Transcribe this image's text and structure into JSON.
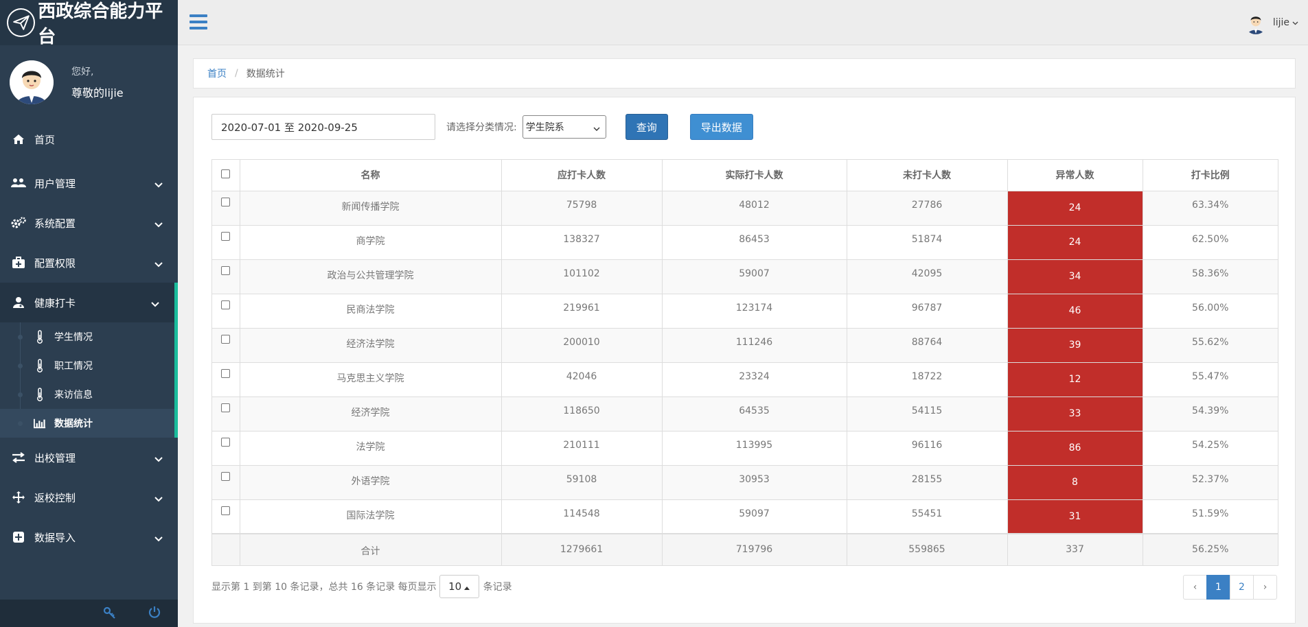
{
  "brand": {
    "title": "西政综合能力平台"
  },
  "profile": {
    "greeting": "您好,",
    "name": "尊敬的lijie"
  },
  "sidebar": {
    "items": [
      {
        "label": "首页",
        "icon": "home-icon"
      },
      {
        "label": "用户管理",
        "icon": "users-icon"
      },
      {
        "label": "系统配置",
        "icon": "gears-icon"
      },
      {
        "label": "配置权限",
        "icon": "medkit-icon"
      },
      {
        "label": "健康打卡",
        "icon": "user-md-icon"
      },
      {
        "label": "出校管理",
        "icon": "exchange-icon"
      },
      {
        "label": "返校控制",
        "icon": "move-icon"
      },
      {
        "label": "数据导入",
        "icon": "plus-square-icon"
      }
    ],
    "sub_items": [
      {
        "label": "学生情况",
        "icon": "thermometer-icon"
      },
      {
        "label": "职工情况",
        "icon": "thermometer-icon"
      },
      {
        "label": "来访信息",
        "icon": "thermometer-icon"
      },
      {
        "label": "数据统计",
        "icon": "bar-chart-icon"
      }
    ],
    "accent": "#1abc9c"
  },
  "topbar": {
    "username": "lijie"
  },
  "breadcrumb": {
    "home": "首页",
    "current": "数据统计"
  },
  "filters": {
    "date_range": "2020-07-01 至 2020-09-25",
    "category_label": "请选择分类情况:",
    "category_selected": "学生院系",
    "query_button": "查询",
    "export_button": "导出数据"
  },
  "table": {
    "headers": [
      "名称",
      "应打卡人数",
      "实际打卡人数",
      "未打卡人数",
      "异常人数",
      "打卡比例"
    ],
    "rows": [
      [
        "新闻传播学院",
        "75798",
        "48012",
        "27786",
        "24",
        "63.34%"
      ],
      [
        "商学院",
        "138327",
        "86453",
        "51874",
        "24",
        "62.50%"
      ],
      [
        "政治与公共管理学院",
        "101102",
        "59007",
        "42095",
        "34",
        "58.36%"
      ],
      [
        "民商法学院",
        "219961",
        "123174",
        "96787",
        "46",
        "56.00%"
      ],
      [
        "经济法学院",
        "200010",
        "111246",
        "88764",
        "39",
        "55.62%"
      ],
      [
        "马克思主义学院",
        "42046",
        "23324",
        "18722",
        "12",
        "55.47%"
      ],
      [
        "经济学院",
        "118650",
        "64535",
        "54115",
        "33",
        "54.39%"
      ],
      [
        "法学院",
        "210111",
        "113995",
        "96116",
        "86",
        "54.25%"
      ],
      [
        "外语学院",
        "59108",
        "30953",
        "28155",
        "8",
        "52.37%"
      ],
      [
        "国际法学院",
        "114548",
        "59097",
        "55451",
        "31",
        "51.59%"
      ]
    ],
    "total": [
      "合计",
      "1279661",
      "719796",
      "559865",
      "337",
      "56.25%"
    ],
    "abnormal_color": "#c12e2a"
  },
  "pager": {
    "info_prefix": "显示第 1 到第 10 条记录，总共 16 条记录 每页显示",
    "page_size": "10",
    "info_suffix": "条记录",
    "prev": "‹",
    "pages": [
      "1",
      "2"
    ],
    "next": "›",
    "active_page": "1"
  }
}
